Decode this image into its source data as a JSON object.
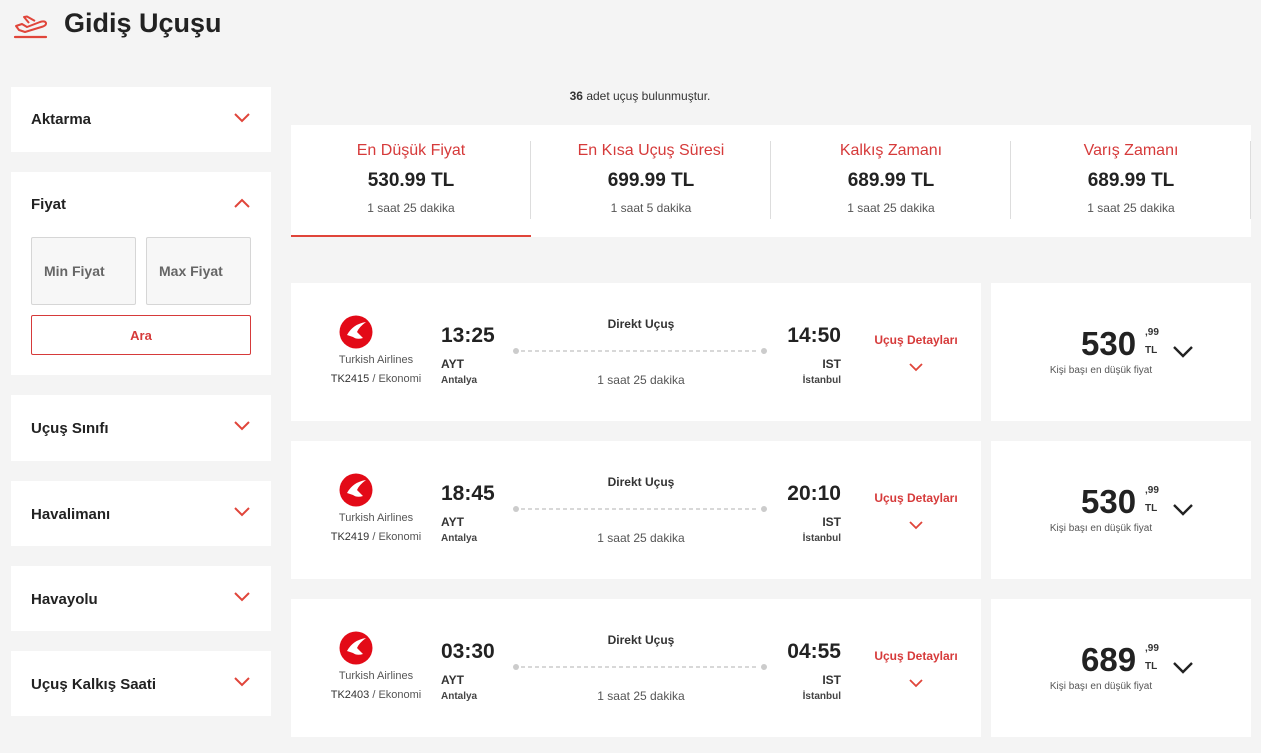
{
  "header": {
    "title": "Gidiş Uçuşu",
    "icon": "departure-plane-icon"
  },
  "filters": {
    "aktarma": {
      "label": "Aktarma",
      "expanded": false
    },
    "fiyat": {
      "label": "Fiyat",
      "expanded": true,
      "min_placeholder": "Min Fiyat",
      "max_placeholder": "Max Fiyat",
      "min_value": "",
      "max_value": "",
      "search_button": "Ara"
    },
    "ucus_sinifi": {
      "label": "Uçuş Sınıfı",
      "expanded": false
    },
    "havalimani": {
      "label": "Havalimanı",
      "expanded": false
    },
    "havayolu": {
      "label": "Havayolu",
      "expanded": false
    },
    "kalkis_saati": {
      "label": "Uçuş Kalkış Saati",
      "expanded": false
    }
  },
  "results": {
    "count": "36",
    "count_suffix": "adet uçuş bulunmuştur."
  },
  "sort_tabs": [
    {
      "label": "En Düşük Fiyat",
      "price": "530.99 TL",
      "duration": "1 saat 25 dakika",
      "active": true
    },
    {
      "label": "En Kısa Uçuş Süresi",
      "price": "699.99 TL",
      "duration": "1 saat 5 dakika",
      "active": false
    },
    {
      "label": "Kalkış Zamanı",
      "price": "689.99 TL",
      "duration": "1 saat 25 dakika",
      "active": false
    },
    {
      "label": "Varış Zamanı",
      "price": "689.99 TL",
      "duration": "1 saat 25 dakika",
      "active": false
    }
  ],
  "flights": [
    {
      "airline": "Turkish Airlines",
      "flight_no": "TK2415",
      "cabin": "Ekonomi",
      "dep_time": "13:25",
      "dep_code": "AYT",
      "dep_city": "Antalya",
      "arr_time": "14:50",
      "arr_code": "IST",
      "arr_city": "İstanbul",
      "type": "Direkt Uçuş",
      "duration": "1 saat 25 dakika",
      "details_label": "Uçuş Detayları",
      "price_int": "530",
      "price_dec": ",99",
      "currency": "TL",
      "price_label": "Kişi başı en düşük fiyat"
    },
    {
      "airline": "Turkish Airlines",
      "flight_no": "TK2419",
      "cabin": "Ekonomi",
      "dep_time": "18:45",
      "dep_code": "AYT",
      "dep_city": "Antalya",
      "arr_time": "20:10",
      "arr_code": "IST",
      "arr_city": "İstanbul",
      "type": "Direkt Uçuş",
      "duration": "1 saat 25 dakika",
      "details_label": "Uçuş Detayları",
      "price_int": "530",
      "price_dec": ",99",
      "currency": "TL",
      "price_label": "Kişi başı en düşük fiyat"
    },
    {
      "airline": "Turkish Airlines",
      "flight_no": "TK2403",
      "cabin": "Ekonomi",
      "dep_time": "03:30",
      "dep_code": "AYT",
      "dep_city": "Antalya",
      "arr_time": "04:55",
      "arr_code": "IST",
      "arr_city": "İstanbul",
      "type": "Direkt Uçuş",
      "duration": "1 saat 25 dakika",
      "details_label": "Uçuş Detayları",
      "price_int": "689",
      "price_dec": ",99",
      "currency": "TL",
      "price_label": "Kişi başı en düşük fiyat"
    }
  ],
  "colors": {
    "accent": "#d63a3a",
    "airline_red": "#e30a17",
    "background": "#f4f4f4"
  }
}
